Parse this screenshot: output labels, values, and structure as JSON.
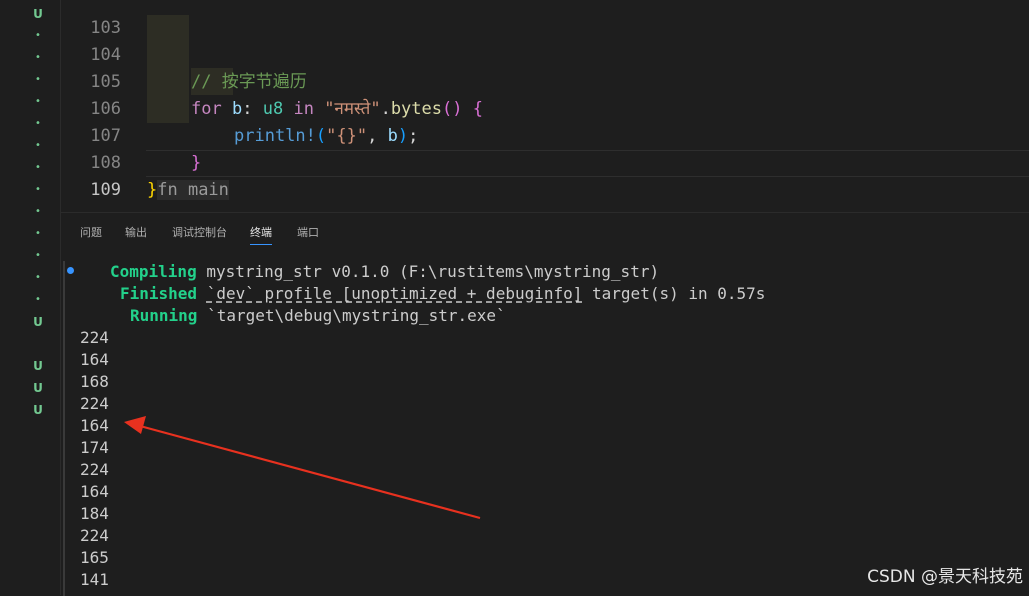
{
  "explorer": {
    "markers": [
      "U",
      "•",
      "•",
      "•",
      "•",
      "•",
      "•",
      "•",
      "•",
      "•",
      "•",
      "•",
      "•",
      "•",
      "U",
      "U",
      "U",
      "U"
    ]
  },
  "editor": {
    "lines": [
      {
        "num": "103"
      },
      {
        "num": "104",
        "comment": "// 按字节遍历"
      },
      {
        "num": "105",
        "kw_for": "for",
        "var_b": "b",
        "colon": ":",
        "type": "u8",
        "kw_in": "in",
        "str": "\"नमस्ते\"",
        "method_dot": ".",
        "method": "bytes",
        "paren": "()",
        "brace": "{"
      },
      {
        "num": "106",
        "macro": "println!",
        "open": "(",
        "fmt": "\"{}\"",
        "comma": ", ",
        "arg": "b",
        "close": ")",
        "semi": ";"
      },
      {
        "num": "107",
        "brace": "}"
      },
      {
        "num": "108",
        "brace": "}",
        "hint": "fn main"
      },
      {
        "num": "109"
      }
    ]
  },
  "panel": {
    "tabs": [
      "问题",
      "输出",
      "调试控制台",
      "终端",
      "端口"
    ],
    "active_tab": "终端"
  },
  "terminal": {
    "compiling_kw": "Compiling",
    "compiling_rest": "mystring_str v0.1.0 (F:\\rustitems\\mystring_str)",
    "finished_kw": "Finished",
    "finished_profile": "`dev` profile [unoptimized + debuginfo]",
    "finished_rest": " target(s) in 0.57s",
    "running_kw": "Running",
    "running_rest": "`target\\debug\\mystring_str.exe`",
    "output": [
      "224",
      "164",
      "168",
      "224",
      "164",
      "174",
      "224",
      "164",
      "184",
      "224",
      "165",
      "141"
    ]
  },
  "watermark": "CSDN @景天科技苑",
  "colors": {
    "background": "#1e1e1e",
    "keyword": "#c586c0",
    "string": "#ce9178",
    "comment": "#6a9955",
    "cargo_status": "#23d18b",
    "arrow": "#e8311f",
    "active_tab_underline": "#3794ff"
  },
  "annotation": {
    "type": "red-arrow",
    "points_to_output_index": 4
  }
}
